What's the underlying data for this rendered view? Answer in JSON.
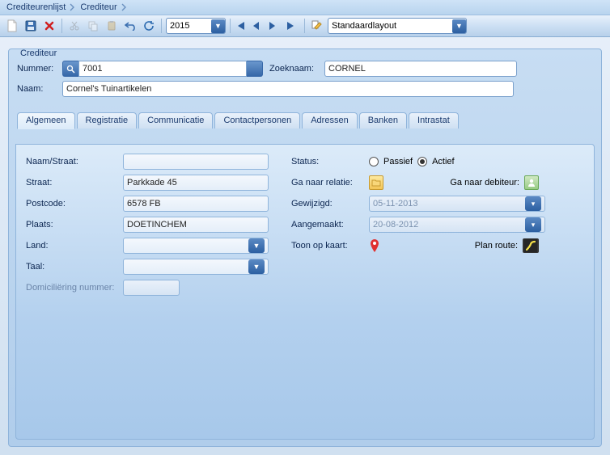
{
  "breadcrumb": {
    "items": [
      "Crediteurenlijst",
      "Crediteur"
    ]
  },
  "toolbar": {
    "year": "2015",
    "layout": "Standaardlayout"
  },
  "group": {
    "title": "Crediteur"
  },
  "header": {
    "nummer_label": "Nummer:",
    "nummer": "7001",
    "zoeknaam_label": "Zoeknaam:",
    "zoeknaam": "CORNEL",
    "naam_label": "Naam:",
    "naam": "Cornel's Tuinartikelen"
  },
  "tabs": [
    "Algemeen",
    "Registratie",
    "Communicatie",
    "Contactpersonen",
    "Adressen",
    "Banken",
    "Intrastat"
  ],
  "active_tab": 0,
  "algemeen": {
    "labels": {
      "naam_straat": "Naam/Straat:",
      "straat": "Straat:",
      "postcode": "Postcode:",
      "plaats": "Plaats:",
      "land": "Land:",
      "taal": "Taal:",
      "domiciliering": "Domiciliëring nummer:",
      "status": "Status:",
      "passief": "Passief",
      "actief": "Actief",
      "ga_relatie": "Ga naar relatie:",
      "ga_debiteur": "Ga naar debiteur:",
      "gewijzigd": "Gewijzigd:",
      "aangemaakt": "Aangemaakt:",
      "toon_kaart": "Toon op kaart:",
      "plan_route": "Plan route:"
    },
    "values": {
      "naam_straat": "",
      "straat": "Parkkade 45",
      "postcode": "6578 FB",
      "plaats": "DOETINCHEM",
      "land": "",
      "taal": "",
      "domiciliering": "",
      "gewijzigd": "05-11-2013",
      "aangemaakt": "20-08-2012",
      "status_active": true
    }
  }
}
